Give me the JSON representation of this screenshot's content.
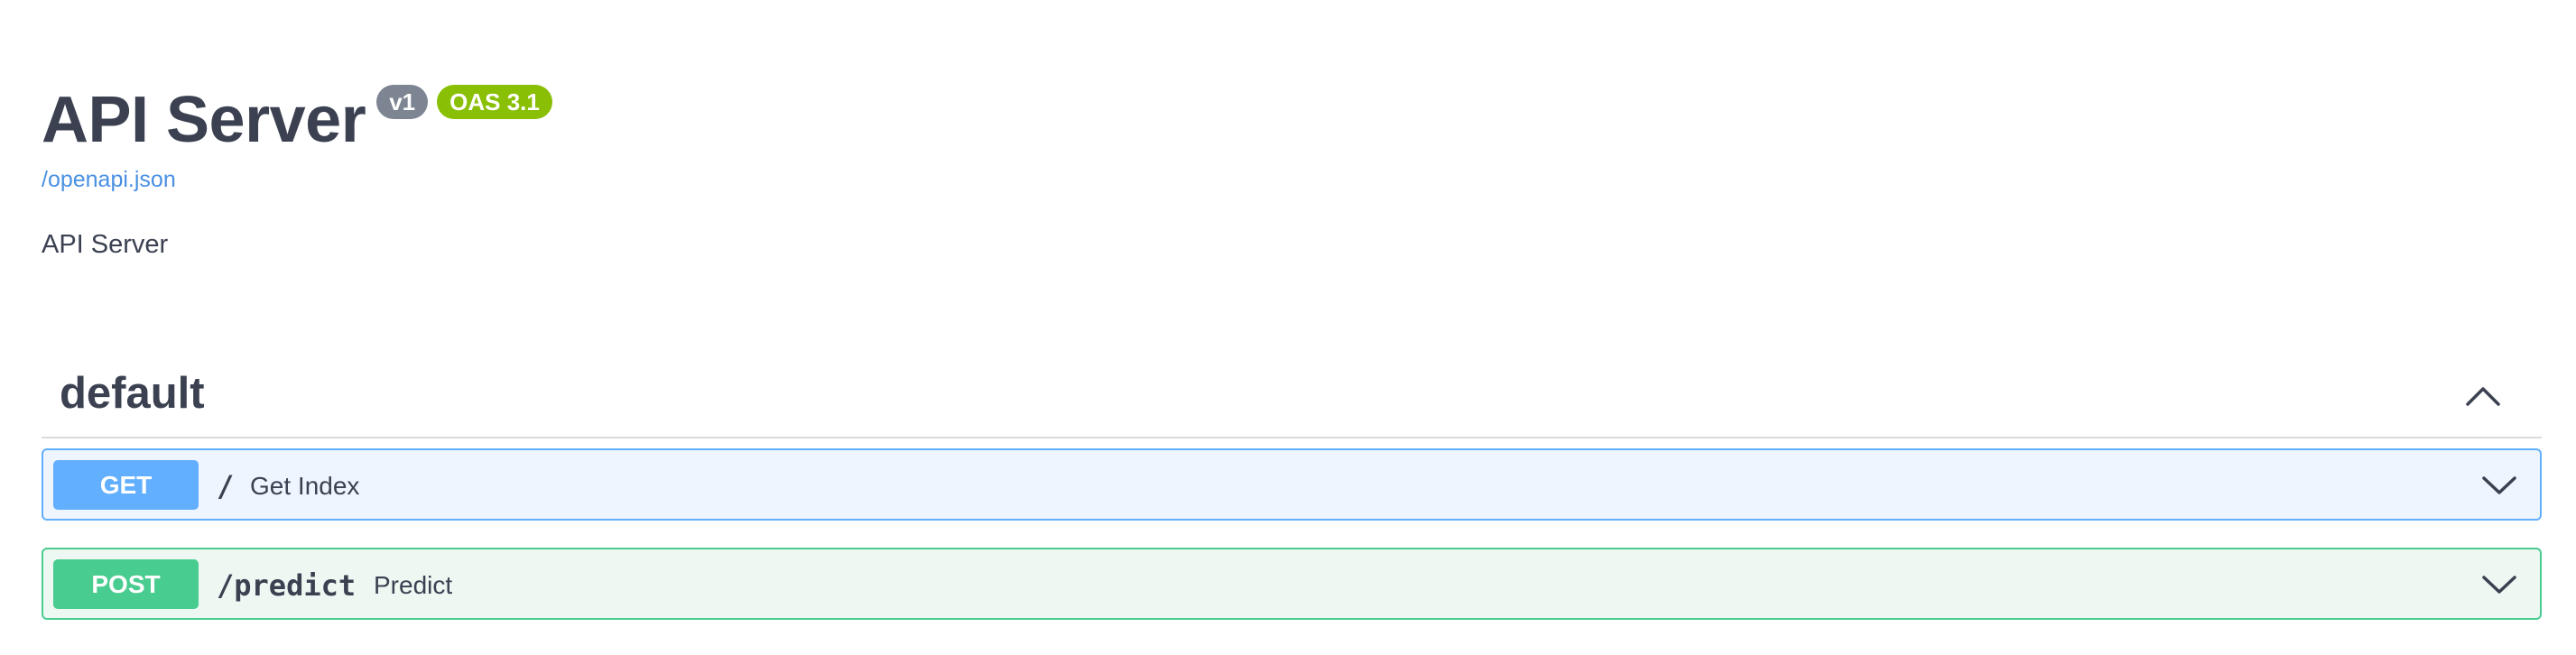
{
  "info": {
    "title": "API Server",
    "version_badge": "v1",
    "oas_badge": "OAS 3.1",
    "spec_link": "/openapi.json",
    "description": "API Server"
  },
  "tag": {
    "name": "default",
    "expanded": true,
    "toggle_icon": "chevron-up-icon"
  },
  "operations": [
    {
      "method": "GET",
      "path": "/",
      "summary": "Get Index",
      "color": "#61affe",
      "background": "#eff5fe",
      "expand_icon": "chevron-down-icon"
    },
    {
      "method": "POST",
      "path": "/predict",
      "summary": "Predict",
      "color": "#49cc90",
      "background": "#edf8f2",
      "expand_icon": "chevron-down-icon"
    }
  ],
  "colors": {
    "text": "#3b4151",
    "link": "#4990e2",
    "version_badge": "#7d8492",
    "oas_badge": "#89bf04"
  }
}
